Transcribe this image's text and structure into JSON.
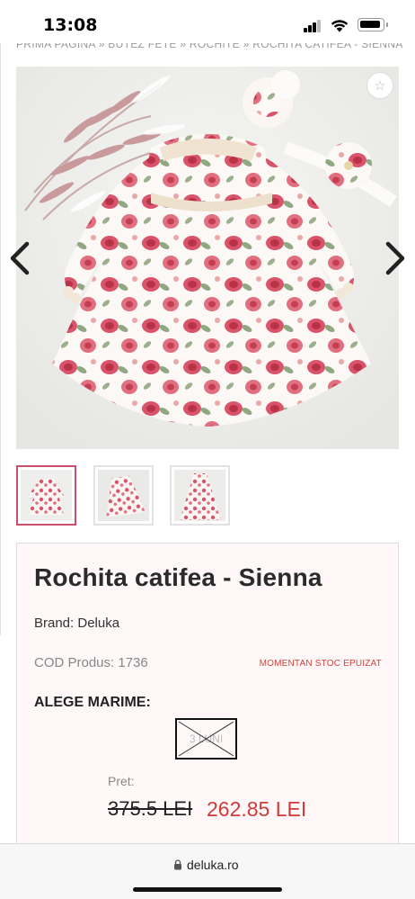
{
  "status_bar": {
    "time": "13:08"
  },
  "breadcrumb": "PRIMA PAGINA » BUTEZ FETE » ROCHITE » ROCHITA CATIFEA - SIENNA",
  "gallery": {
    "favorite_icon": "☆",
    "thumbnail_count": 3,
    "active_thumbnail": 1
  },
  "product": {
    "title": "Rochita catifea - Sienna",
    "brand": "Brand: Deluka",
    "code": "COD Produs: 1736",
    "stock_status": "MOMENTAN STOC EPUIZAT",
    "size_heading": "ALEGE MARIME:",
    "size_option": "3 LUNI",
    "price_label": "Pret:",
    "old_price": "375.5 LEI",
    "new_price": "262.85 LEI"
  },
  "browser": {
    "url": "deluka.ro"
  },
  "colors": {
    "accent_red": "#d03a38",
    "active_thumb_border": "#c9506a",
    "card_background": "#fff7f8",
    "rose": "#d9546a"
  }
}
